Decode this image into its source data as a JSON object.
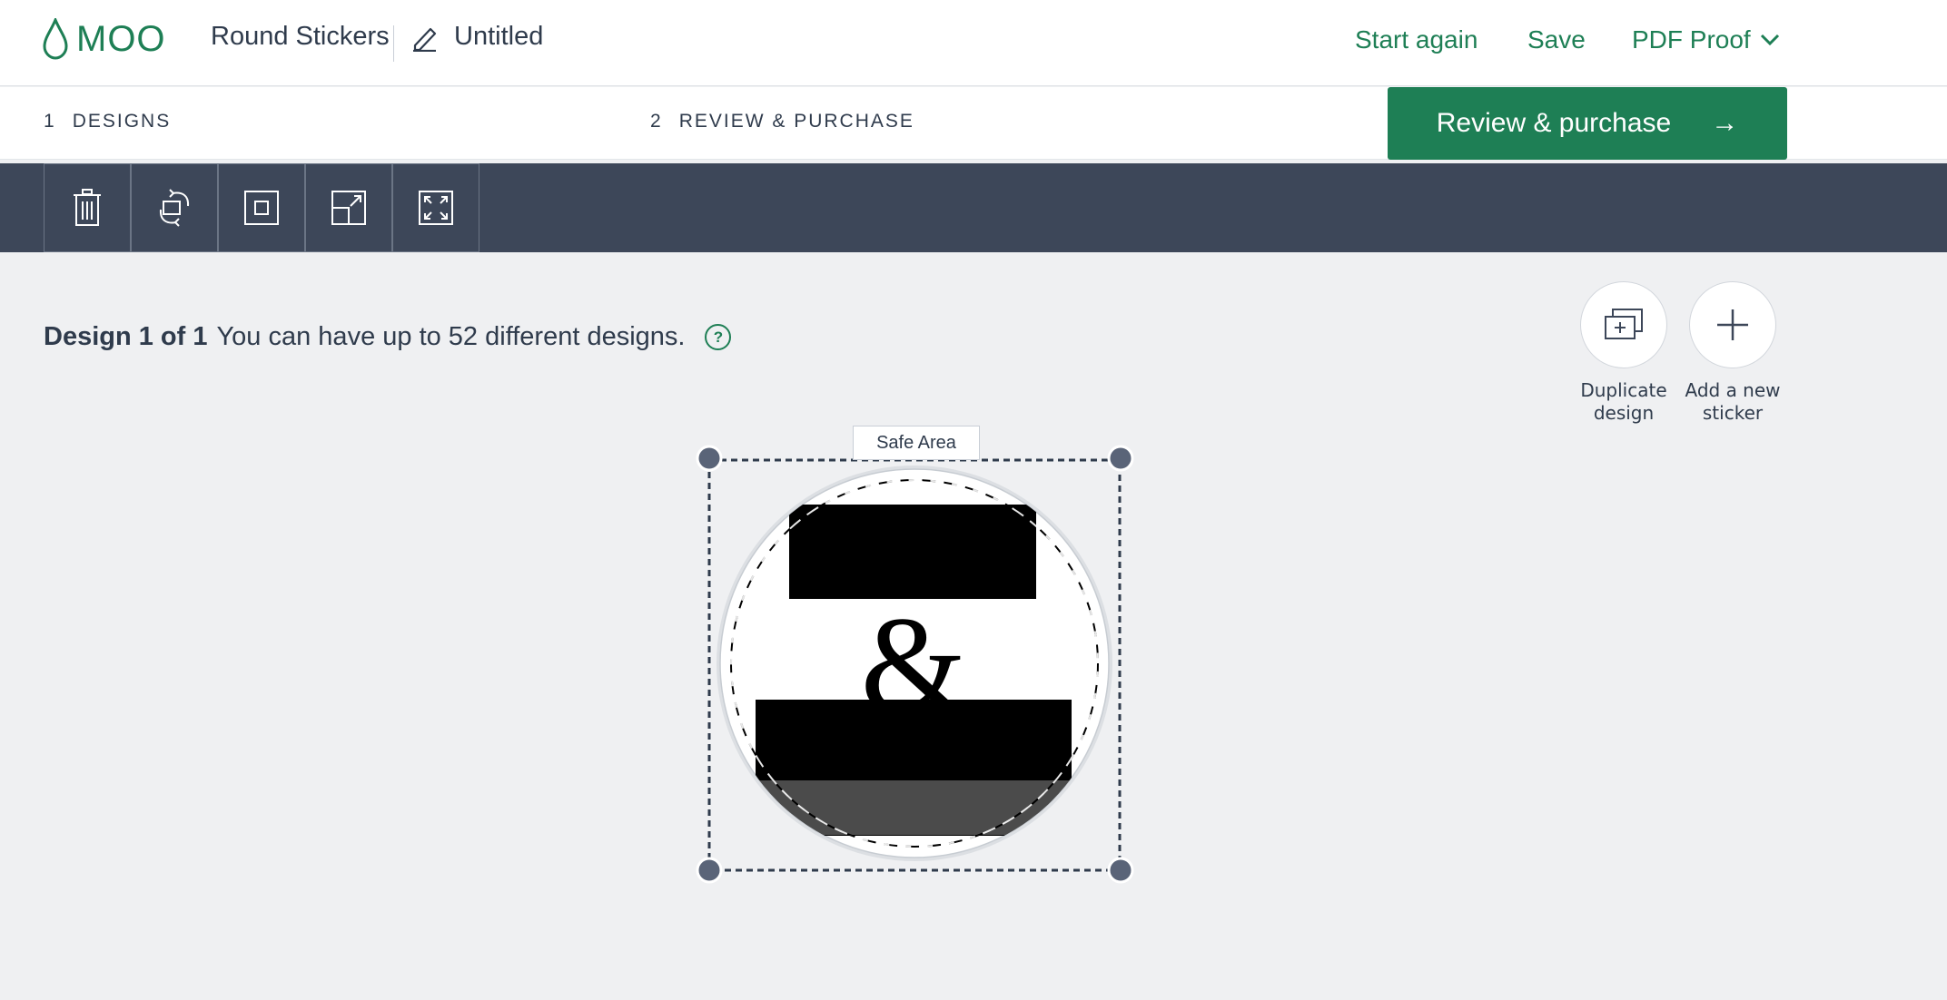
{
  "header": {
    "logo_text": "MOO",
    "product_name": "Round Stickers",
    "design_title": "Untitled",
    "start_again": "Start again",
    "save": "Save",
    "pdf_proof": "PDF Proof"
  },
  "steps": [
    {
      "number": "1",
      "label": "DESIGNS"
    },
    {
      "number": "2",
      "label": "REVIEW & PURCHASE"
    }
  ],
  "review_button": {
    "label": "Review & purchase",
    "arrow": "→"
  },
  "toolbar": {
    "tools": [
      {
        "icon": "trash-icon"
      },
      {
        "icon": "rotate-swap-icon"
      },
      {
        "icon": "fit-center-icon"
      },
      {
        "icon": "scale-corner-icon"
      },
      {
        "icon": "fullscreen-expand-icon"
      }
    ]
  },
  "design_info": {
    "count_label": "Design 1 of 1",
    "limit_text": "You can have up to 52 different designs.",
    "help_glyph": "?"
  },
  "actions": {
    "duplicate_line1": "Duplicate",
    "duplicate_line2": "design",
    "add_line1": "Add a new",
    "add_line2": "sticker"
  },
  "canvas": {
    "safe_area_label": "Safe Area",
    "glyph": "&"
  },
  "colors": {
    "brand_green": "#1e7f55",
    "toolbar_bg": "#3d4759",
    "page_bg": "#eff0f2"
  }
}
